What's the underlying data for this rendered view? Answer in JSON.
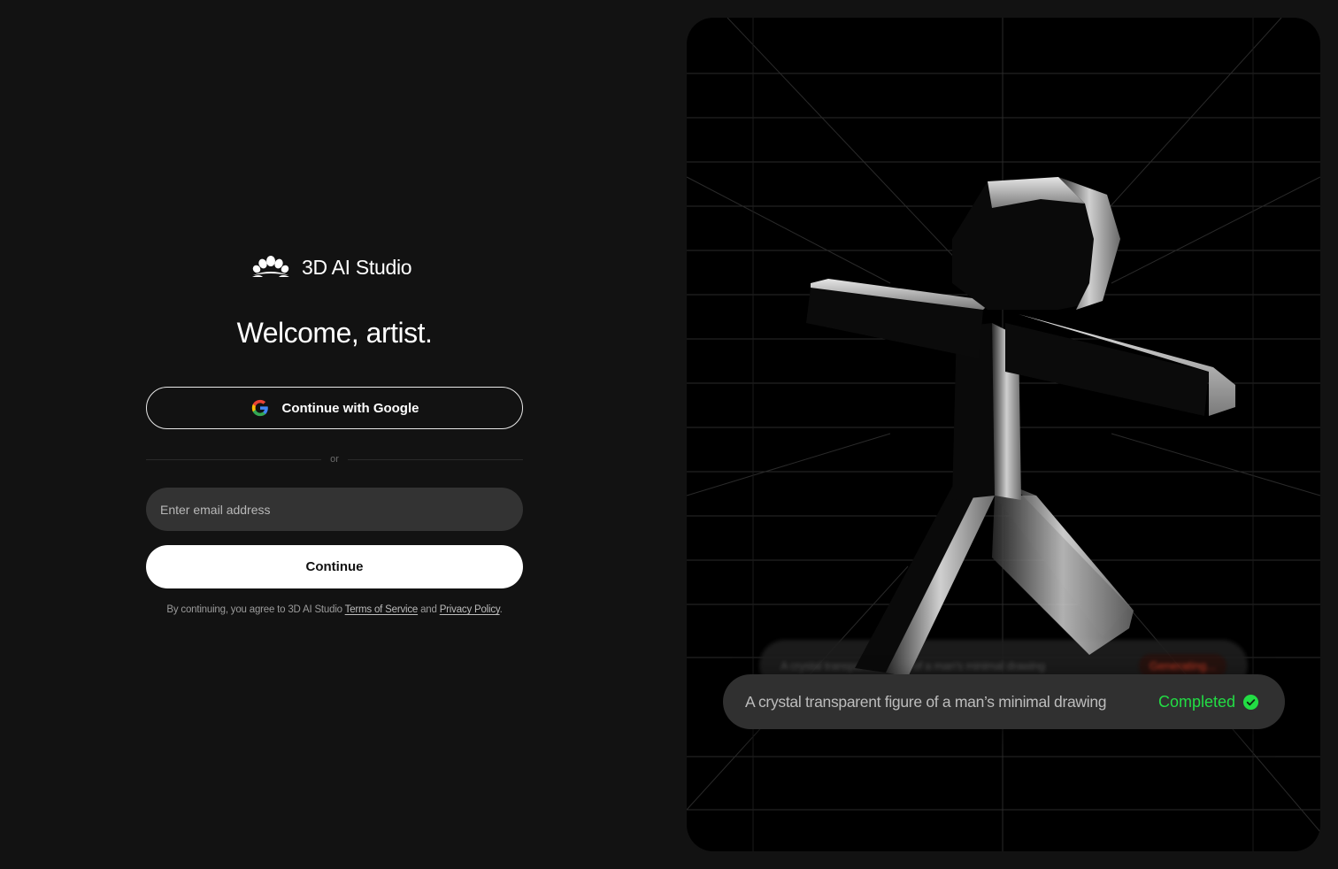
{
  "brand": {
    "name": "3D AI Studio",
    "icon": "flower-logo-icon"
  },
  "login": {
    "heading": "Welcome, artist.",
    "google_button": "Continue with Google",
    "divider": "or",
    "email_placeholder": "Enter email address",
    "continue_button": "Continue",
    "legal": {
      "prefix": "By continuing, you agree to 3D AI Studio ",
      "terms": "Terms of Service",
      "and": " and ",
      "privacy": "Privacy Policy",
      "suffix": "."
    }
  },
  "preview": {
    "background_prompt": "A crystal transparent figure of a man's minimal drawing",
    "background_status": "Generating...",
    "prompt": "A crystal transparent figure of a man’s minimal drawing",
    "status": "Completed",
    "status_color": "#22dd44",
    "status_icon": "check-circle-icon"
  }
}
